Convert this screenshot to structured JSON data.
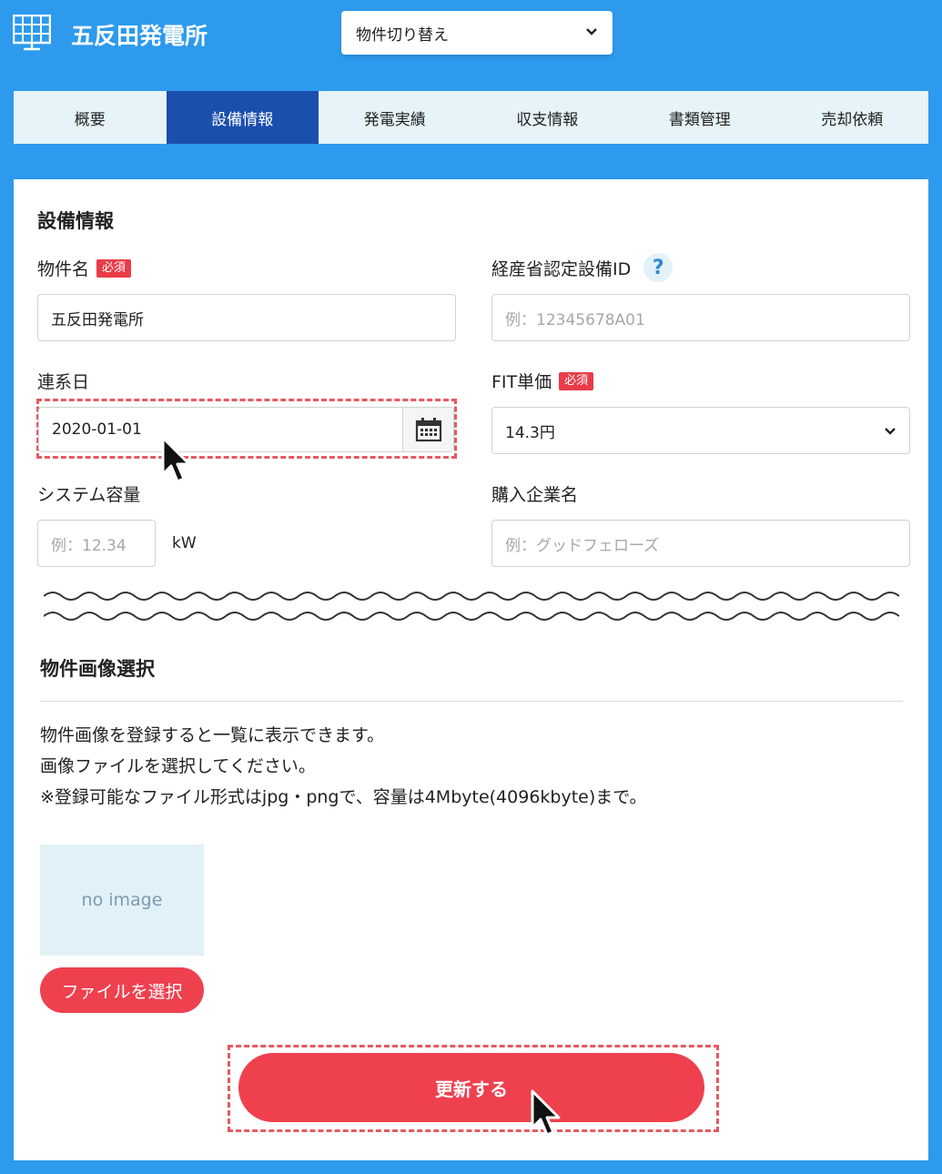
{
  "header": {
    "title": "五反田発電所",
    "property_switch_label": "物件切り替え"
  },
  "tabs": [
    {
      "label": "概要"
    },
    {
      "label": "設備情報",
      "active": true
    },
    {
      "label": "発電実績"
    },
    {
      "label": "収支情報"
    },
    {
      "label": "書類管理"
    },
    {
      "label": "売却依頼"
    }
  ],
  "form": {
    "section_title": "設備情報",
    "required_badge": "必須",
    "property_name": {
      "label": "物件名",
      "value": "五反田発電所"
    },
    "meti_id": {
      "label": "経産省認定設備ID",
      "placeholder": "例：12345678A01",
      "help_icon": "?"
    },
    "connection_date": {
      "label": "連系日",
      "value": "2020-01-01"
    },
    "fit_price": {
      "label": "FIT単価",
      "value": "14.3円"
    },
    "system_capacity": {
      "label": "システム容量",
      "placeholder": "例：12.34",
      "unit": "kW"
    },
    "buyer_company": {
      "label": "購入企業名",
      "placeholder": "例：グッドフェローズ"
    }
  },
  "image_section": {
    "title": "物件画像選択",
    "description": [
      "物件画像を登録すると一覧に表示できます。",
      "画像ファイルを選択してください。",
      "※登録可能なファイル形式はjpg・pngで、容量は4Mbyte(4096kbyte)まで。"
    ],
    "no_image_label": "no image",
    "select_file_label": "ファイルを選択"
  },
  "update_button_label": "更新する",
  "colors": {
    "background": "#2d9aed",
    "active_tab": "#1b4fae",
    "accent_red": "#ef404e",
    "required_badge": "#ea3c48"
  }
}
